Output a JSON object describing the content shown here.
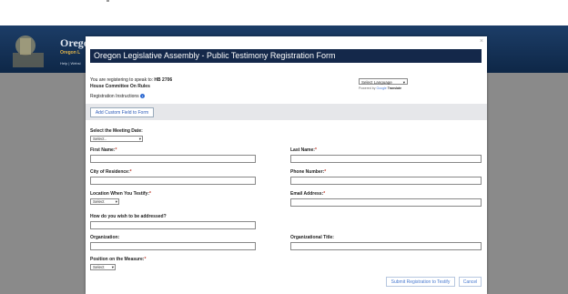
{
  "site": {
    "title": "Orego",
    "subtitle": "Oregon L",
    "links": "Help | Websi"
  },
  "modal": {
    "title": "Oregon Legislative Assembly - Public Testimony Registration Form",
    "close_symbol": "×",
    "speak_prefix": "You are registering to speak to:",
    "bill": "HB 2706",
    "committee": "House Committee On Rules",
    "instructions": "Registration Instructions",
    "language_select": "Select Language",
    "powered_by": "Powered by",
    "google": "Google",
    "translate": "Translate",
    "add_custom_field": "Add Custom Field to Form",
    "meeting_date_label": "Select the Meeting Date:",
    "meeting_date_value": "Select..",
    "first_name": "First Name:",
    "last_name": "Last Name:",
    "city": "City of Residence:",
    "phone": "Phone Number:",
    "location": "Location When You Testify:",
    "location_value": "Select",
    "email": "Email Address:",
    "addressed": "How do you wish to be addressed?",
    "organization": "Organization:",
    "org_title": "Organizational Title:",
    "position": "Position on the Measure:",
    "position_value": "Select",
    "required_mark": "*",
    "submit": "Submit Registration to Testify",
    "cancel": "Cancel"
  },
  "icons": [
    "capitol-seal-icon",
    "info-icon",
    "dropdown-arrow-icon",
    "close-icon"
  ]
}
